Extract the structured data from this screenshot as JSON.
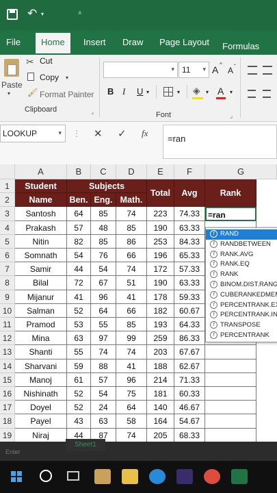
{
  "ribbon_tabs": [
    {
      "label": "File"
    },
    {
      "label": "Home"
    },
    {
      "label": "Insert"
    },
    {
      "label": "Draw"
    },
    {
      "label": "Page Layout"
    },
    {
      "label": "Formulas"
    }
  ],
  "clipboard": {
    "paste": "Paste",
    "cut": "Cut",
    "copy": "Copy",
    "format_painter": "Format Painter",
    "group": "Clipboard"
  },
  "font": {
    "size": "11",
    "bold": "B",
    "italic": "I",
    "underline": "U",
    "font_color": "A",
    "grow": "A",
    "shrink": "A",
    "group": "Font"
  },
  "formula_bar": {
    "name_box": "LOOKUP",
    "cancel": "✕",
    "enter": "✓",
    "fx": "fx",
    "formula": "=ran"
  },
  "columns": [
    "A",
    "B",
    "C",
    "D",
    "E",
    "F",
    "G"
  ],
  "rows": [
    "1",
    "2",
    "3",
    "4",
    "5",
    "6",
    "7",
    "8",
    "9",
    "10",
    "11",
    "12",
    "13",
    "14",
    "15",
    "16",
    "17",
    "18",
    "19",
    "20"
  ],
  "table_header": {
    "student": "Student",
    "name": "Name",
    "subjects": "Subjects",
    "ben": "Ben.",
    "eng": "Eng.",
    "math": "Math.",
    "total": "Total",
    "avg": "Avg",
    "rank": "Rank"
  },
  "table_rows": [
    [
      "Santosh",
      "64",
      "85",
      "74",
      "223",
      "74.33"
    ],
    [
      "Prakash",
      "57",
      "48",
      "85",
      "190",
      "63.33"
    ],
    [
      "Nitin",
      "82",
      "85",
      "86",
      "253",
      "84.33"
    ],
    [
      "Somnath",
      "54",
      "76",
      "66",
      "196",
      "65.33"
    ],
    [
      "Samir",
      "44",
      "54",
      "74",
      "172",
      "57.33"
    ],
    [
      "Bilal",
      "72",
      "67",
      "51",
      "190",
      "63.33"
    ],
    [
      "Mijanur",
      "41",
      "96",
      "41",
      "178",
      "59.33"
    ],
    [
      "Salman",
      "52",
      "64",
      "66",
      "182",
      "60.67"
    ],
    [
      "Pramod",
      "53",
      "55",
      "85",
      "193",
      "64.33"
    ],
    [
      "Mina",
      "63",
      "97",
      "99",
      "259",
      "86.33"
    ],
    [
      "Shanti",
      "55",
      "74",
      "74",
      "203",
      "67.67"
    ],
    [
      "Sharvani",
      "59",
      "88",
      "41",
      "188",
      "62.67"
    ],
    [
      "Manoj",
      "61",
      "57",
      "96",
      "214",
      "71.33"
    ],
    [
      "Nishinath",
      "52",
      "54",
      "75",
      "181",
      "60.33"
    ],
    [
      "Doyel",
      "52",
      "24",
      "64",
      "140",
      "46.67"
    ],
    [
      "Payel",
      "43",
      "63",
      "58",
      "164",
      "54.67"
    ],
    [
      "Niraj",
      "44",
      "87",
      "74",
      "205",
      "68.33"
    ]
  ],
  "active_cell_text": "=ran",
  "autocomplete": [
    "RAND",
    "RANDBETWEEN",
    "RANK.AVG",
    "RANK.EQ",
    "RANK",
    "BINOM.DIST.RANGE",
    "CUBERANKEDMEMBER",
    "PERCENTRANK.EXC",
    "PERCENTRANK.INC",
    "TRANSPOSE",
    "PERCENTRANK"
  ],
  "status": {
    "mode": "Enter",
    "sheet_tab": "Sheet1"
  },
  "colors": {
    "excel_green": "#217346",
    "header_maroon": "#6b1f1a",
    "autocomplete_highlight": "#1e7fd6"
  }
}
